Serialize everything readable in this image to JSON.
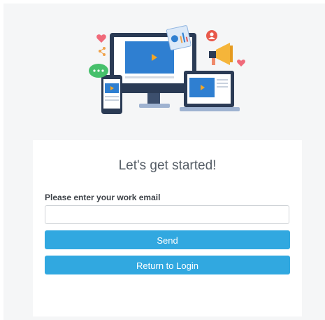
{
  "form": {
    "title": "Let's get started!",
    "email_label": "Please enter your work email",
    "email_value": "",
    "email_placeholder": "",
    "send_label": "Send",
    "return_label": "Return to Login"
  },
  "colors": {
    "primary_button": "#31a8e0",
    "page_background": "#f5f6f7",
    "card_background": "#ffffff"
  },
  "illustration": {
    "icons": [
      "monitor-icon",
      "laptop-icon",
      "phone-icon",
      "heart-icon",
      "chat-bubble-icon",
      "megaphone-icon",
      "user-icon",
      "share-icon",
      "chart-card-icon"
    ]
  }
}
